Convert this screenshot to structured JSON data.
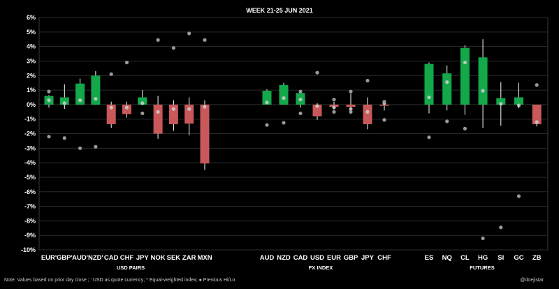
{
  "chart_data": {
    "type": "bar",
    "title": "WEEK  21-25 JUN 2021",
    "ylim": [
      -10,
      6
    ],
    "yticks": [
      6,
      5,
      4,
      3,
      2,
      1,
      0,
      -1,
      -2,
      -3,
      -4,
      -5,
      -6,
      -7,
      -8,
      -9,
      -10
    ],
    "ytick_suffix": "%",
    "grid": true,
    "colors": {
      "up": "#13a84a",
      "down": "#c9585a",
      "background": "#000000",
      "grid": "#2c2c2c",
      "marker": "#9a9a9a",
      "wick": "#ffffff"
    },
    "groups": [
      {
        "label": "USD PAIRS",
        "items": [
          {
            "label": "EUR'",
            "open": 0,
            "close": 0.6,
            "high": 0.65,
            "low": -0.2,
            "prev": 0.3,
            "prev_hi": 0.9,
            "prev_lo": -2.2
          },
          {
            "label": "GBP'",
            "open": 0,
            "close": 0.5,
            "high": 1.4,
            "low": -0.3,
            "prev": 0.1,
            "prev_hi": 0.9,
            "prev_lo": -2.3
          },
          {
            "label": "AUD'",
            "open": 0,
            "close": 1.45,
            "high": 1.8,
            "low": 0,
            "prev": 0.3,
            "prev_hi": 0.9,
            "prev_lo": -3.0
          },
          {
            "label": "NZD'",
            "open": 0,
            "close": 2.0,
            "high": 2.3,
            "low": 0,
            "prev": 0.4,
            "prev_hi": 0.9,
            "prev_lo": -2.9
          },
          {
            "label": "CAD",
            "open": 0,
            "close": -1.35,
            "high": 0.2,
            "low": -1.6,
            "prev": -0.2,
            "prev_hi": 2.1,
            "prev_lo": -0.6
          },
          {
            "label": "CHF",
            "open": 0,
            "close": -0.65,
            "high": 0.2,
            "low": -0.9,
            "prev": -0.2,
            "prev_hi": 2.9,
            "prev_lo": -0.3
          },
          {
            "label": "JPY",
            "open": 0,
            "close": 0.5,
            "high": 1.0,
            "low": 0,
            "prev": 0.1,
            "prev_hi": 1.0,
            "prev_lo": -0.6
          },
          {
            "label": "NOK",
            "open": 0,
            "close": -2.0,
            "high": 0.6,
            "low": -2.35,
            "prev": -0.5,
            "prev_hi": 4.45,
            "prev_lo": -0.6
          },
          {
            "label": "SEK",
            "open": 0,
            "close": -1.35,
            "high": 0.3,
            "low": -1.8,
            "prev": -0.3,
            "prev_hi": 3.9,
            "prev_lo": -0.6
          },
          {
            "label": "ZAR",
            "open": 0,
            "close": -1.3,
            "high": 0.5,
            "low": -2.1,
            "prev": -0.3,
            "prev_hi": 4.9,
            "prev_lo": -0.6
          },
          {
            "label": "MXN",
            "open": 0,
            "close": -4.05,
            "high": 0.3,
            "low": -4.5,
            "prev": -0.15,
            "prev_hi": 4.45,
            "prev_lo": -0.6
          }
        ]
      },
      {
        "label": "FX INDEX",
        "items": [
          {
            "label": "AUD",
            "open": 0,
            "close": 0.95,
            "high": 1.05,
            "low": 0,
            "prev": 0.15,
            "prev_hi": 0.9,
            "prev_lo": -1.4
          },
          {
            "label": "NZD",
            "open": 0,
            "close": 1.35,
            "high": 1.5,
            "low": 0,
            "prev": 0.45,
            "prev_hi": 0.9,
            "prev_lo": -1.25
          },
          {
            "label": "CAD",
            "open": 0,
            "close": 0.8,
            "high": 0.85,
            "low": -0.2,
            "prev": 0.35,
            "prev_hi": 0.9,
            "prev_lo": -0.6
          },
          {
            "label": "USD",
            "open": 0,
            "close": -0.8,
            "high": 0.1,
            "low": -1.05,
            "prev": -0.1,
            "prev_hi": 2.2,
            "prev_lo": -0.6
          },
          {
            "label": "EUR",
            "open": 0,
            "close": -0.15,
            "high": 0.2,
            "low": -0.3,
            "prev": -0.2,
            "prev_hi": 0.35,
            "prev_lo": -0.5
          },
          {
            "label": "GBP",
            "open": 0,
            "close": -0.15,
            "high": 0.75,
            "low": -0.35,
            "prev": -0.3,
            "prev_hi": 0.9,
            "prev_lo": -0.5
          },
          {
            "label": "JPY",
            "open": 0,
            "close": -1.35,
            "high": 0.5,
            "low": -1.7,
            "prev": -0.5,
            "prev_hi": 1.65,
            "prev_lo": -0.6
          },
          {
            "label": "CHF",
            "open": 0,
            "close": -0.08,
            "high": 0.15,
            "low": -0.4,
            "prev": 0.1,
            "prev_hi": 0.2,
            "prev_lo": -1.05
          }
        ]
      },
      {
        "label": "FUTURES",
        "items": [
          {
            "label": "ES",
            "open": 0,
            "close": 2.8,
            "high": 2.9,
            "low": -0.6,
            "prev": 0.5,
            "prev_hi": 0.9,
            "prev_lo": -2.25
          },
          {
            "label": "NQ",
            "open": 0,
            "close": 2.15,
            "high": 2.7,
            "low": -0.4,
            "prev": 1.55,
            "prev_hi": 0.9,
            "prev_lo": -1.15
          },
          {
            "label": "CL",
            "open": 0,
            "close": 3.9,
            "high": 4.1,
            "low": -0.7,
            "prev": 2.9,
            "prev_hi": 0.9,
            "prev_lo": -1.65
          },
          {
            "label": "HG",
            "open": 0,
            "close": 3.25,
            "high": 4.5,
            "low": -1.6,
            "prev": 0.95,
            "prev_hi": 0.9,
            "prev_lo": -9.2
          },
          {
            "label": "SI",
            "open": 0,
            "close": 0.45,
            "high": 1.55,
            "low": -1.45,
            "prev": 0.05,
            "prev_hi": 0.9,
            "prev_lo": -8.45
          },
          {
            "label": "GC",
            "open": 0,
            "close": 0.5,
            "high": 1.5,
            "low": -0.25,
            "prev": -0.05,
            "prev_hi": 0.9,
            "prev_lo": -6.3
          },
          {
            "label": "ZB",
            "open": 0,
            "close": -1.35,
            "high": -0.1,
            "low": -1.5,
            "prev": -1.2,
            "prev_hi": 1.35,
            "prev_lo": -0.6
          }
        ]
      }
    ]
  },
  "footer": {
    "note": "Note:  Values based on prior day close ;  ' USD as quote currency;  * Equal-weighted index;  ● Previous Hi/Lo",
    "handle": "@doejistar"
  }
}
